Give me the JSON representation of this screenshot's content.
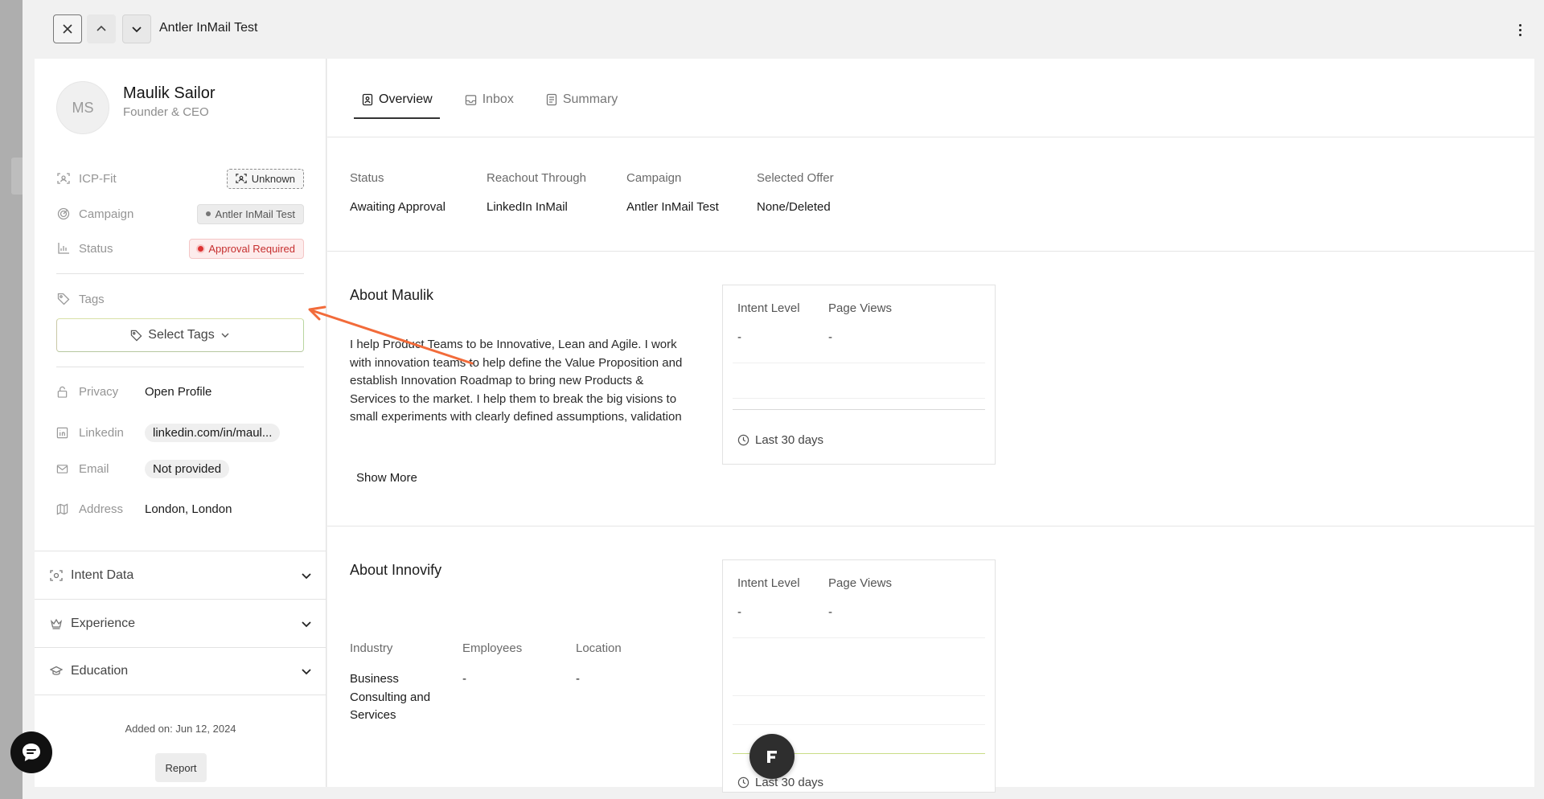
{
  "topbar": {
    "title": "Antler InMail Test"
  },
  "profile": {
    "initials": "MS",
    "name": "Maulik Sailor",
    "title": "Founder & CEO"
  },
  "fields": {
    "icp_label": "ICP-Fit",
    "icp_value": "Unknown",
    "campaign_label": "Campaign",
    "campaign_value": "Antler InMail Test",
    "status_label": "Status",
    "status_value": "Approval Required",
    "tags_label": "Tags",
    "select_tags": "Select Tags",
    "privacy_label": "Privacy",
    "privacy_value": "Open Profile",
    "linkedin_label": "Linkedin",
    "linkedin_value": "linkedin.com/in/maul...",
    "email_label": "Email",
    "email_value": "Not provided",
    "address_label": "Address",
    "address_value": "London, London"
  },
  "accordions": {
    "intent": "Intent Data",
    "experience": "Experience",
    "education": "Education"
  },
  "footer": {
    "added": "Added on: Jun 12, 2024",
    "report": "Report"
  },
  "tabs": {
    "overview": "Overview",
    "inbox": "Inbox",
    "summary": "Summary"
  },
  "summary": {
    "status_h": "Status",
    "status_v": "Awaiting Approval",
    "reachout_h": "Reachout Through",
    "reachout_v": "LinkedIn InMail",
    "campaign_h": "Campaign",
    "campaign_v": "Antler InMail Test",
    "offer_h": "Selected Offer",
    "offer_v": "None/Deleted"
  },
  "about_person": {
    "title": "About Maulik",
    "text": "I help Product Teams to be Innovative, Lean and Agile. I work with innovation teams to help define the Value Proposition and establish Innovation Roadmap to bring new Products & Services to the market. I help them to break the big visions to small experiments with clearly defined assumptions, validation and success KPIs. I then lead the teams to iterate through these experiments using lean principles. I typically",
    "show_more": "Show More"
  },
  "intent_card_1": {
    "intent_h": "Intent Level",
    "intent_v": "-",
    "views_h": "Page Views",
    "views_v": "-",
    "period": "Last 30 days"
  },
  "about_company": {
    "title": "About Innovify",
    "industry_h": "Industry",
    "industry_v": "Business Consulting and Services",
    "employees_h": "Employees",
    "employees_v": "-",
    "location_h": "Location",
    "location_v": "-"
  },
  "intent_card_2": {
    "intent_h": "Intent Level",
    "intent_v": "-",
    "views_h": "Page Views",
    "views_v": "-",
    "period": "Last 30 days"
  },
  "colors": {
    "accent_arrow": "#f26b3a",
    "approval_red": "#c62f2f",
    "tag_border_green": "#b9d6a0"
  }
}
